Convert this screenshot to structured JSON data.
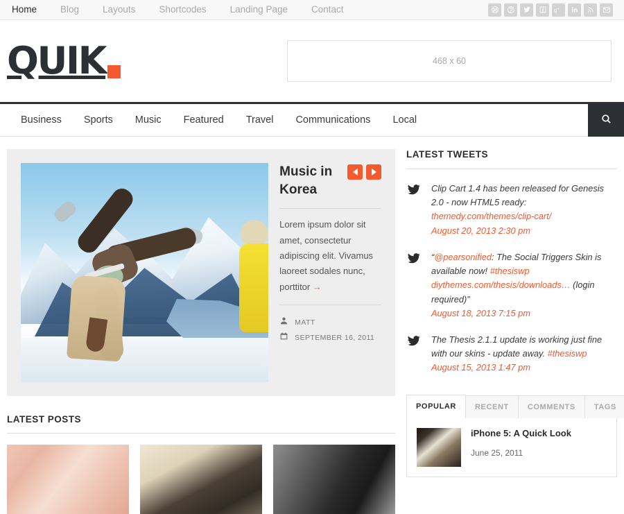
{
  "topbar": {
    "nav": [
      {
        "label": "Home",
        "active": true
      },
      {
        "label": "Blog",
        "active": false
      },
      {
        "label": "Layouts",
        "active": false
      },
      {
        "label": "Shortcodes",
        "active": false
      },
      {
        "label": "Landing Page",
        "active": false
      },
      {
        "label": "Contact",
        "active": false
      }
    ],
    "social": [
      "dribbble-icon",
      "pinterest-icon",
      "twitter-icon",
      "facebook-icon",
      "googleplus-icon",
      "linkedin-icon",
      "rss-icon",
      "email-icon"
    ]
  },
  "header": {
    "logo_text": "QUIK",
    "ad_placeholder": "468 x 60"
  },
  "mainnav": {
    "items": [
      "Business",
      "Sports",
      "Music",
      "Featured",
      "Travel",
      "Communications",
      "Local"
    ],
    "search_icon": "search-icon"
  },
  "featured": {
    "title": "Music in Korea",
    "prev_label": "Previous",
    "next_label": "Next",
    "excerpt": "Lorem ipsum dolor sit amet, consectetur adipiscing elit. Vivamus laoreet sodales nunc, porttitor",
    "more_arrow": "→",
    "author": "MATT",
    "date": "SEPTEMBER 16, 2011"
  },
  "latest_posts": {
    "title": "LATEST POSTS",
    "thumbs": [
      "post-thumb-face",
      "post-thumb-camera",
      "post-thumb-hand"
    ]
  },
  "sidebar": {
    "tweets_title": "LATEST TWEETS",
    "tweets": [
      {
        "text": "Clip Cart 1.4 has been released for Genesis 2.0 - now HTML5 ready: ",
        "link": "themedy.com/themes/clip-cart/",
        "date": "August 20, 2013 2:30 pm"
      },
      {
        "prefix": "“",
        "mention": "@pearsonified",
        "text": ": The Social Triggers Skin is available now! ",
        "hashtag": "#thesiswp",
        "link": "diythemes.com/thesis/downloads…",
        "suffix": " (login required)”",
        "date": "August 18, 2013 7:15 pm"
      },
      {
        "text": "The Thesis 2.1.1 update is working just fine with our skins - update away. ",
        "hashtag": "#thesiswp",
        "date": "August 15, 2013 1:47 pm"
      }
    ],
    "tabs": [
      {
        "label": "POPULAR",
        "active": true
      },
      {
        "label": "RECENT",
        "active": false
      },
      {
        "label": "COMMENTS",
        "active": false
      },
      {
        "label": "TAGS",
        "active": false
      }
    ],
    "popular_post": {
      "title": "iPhone 5: A Quick Look",
      "date": "June 25, 2011"
    }
  },
  "colors": {
    "accent": "#f4592f",
    "dark": "#2c3034",
    "featured_bg": "#eeeeee",
    "muted_text": "#a9a9a9"
  }
}
